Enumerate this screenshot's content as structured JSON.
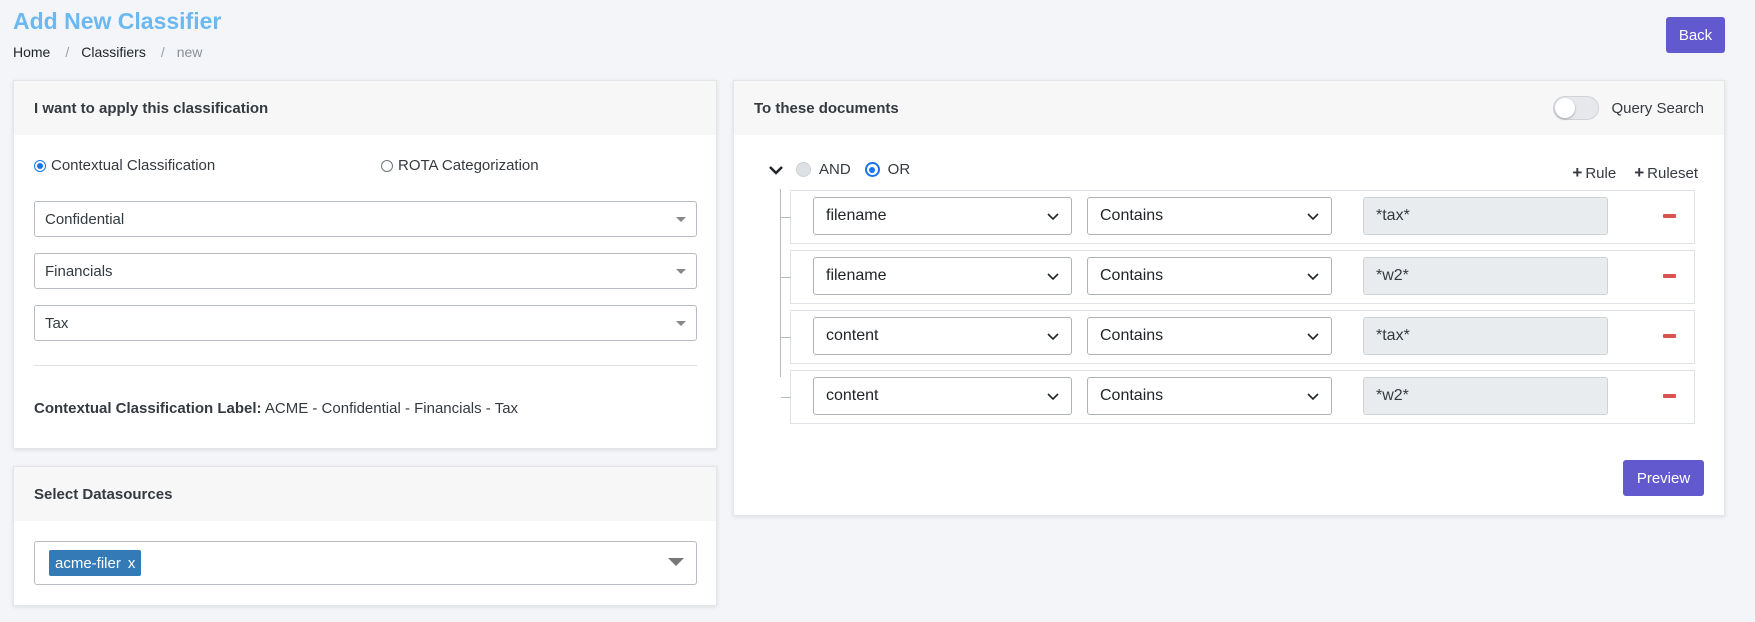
{
  "page": {
    "title": "Add New Classifier"
  },
  "breadcrumb": {
    "home": "Home",
    "sep": "/",
    "classifiers": "Classifiers",
    "current": "new"
  },
  "header": {
    "back_label": "Back"
  },
  "classification_card": {
    "title": "I want to apply this classification",
    "radio_contextual": "Contextual Classification",
    "radio_rota": "ROTA Categorization",
    "selected_mode": "Contextual Classification",
    "select_1": "Confidential",
    "select_2": "Financials",
    "select_3": "Tax",
    "label_title": "Contextual Classification Label:",
    "label_value": "ACME - Confidential - Financials - Tax"
  },
  "datasources_card": {
    "title": "Select Datasources",
    "tag": "acme-filer",
    "tag_remove": "x"
  },
  "documents_card": {
    "title": "To these documents",
    "query_search_label": "Query Search",
    "query_search_on": false,
    "and_label": "AND",
    "or_label": "OR",
    "selected_condition": "OR",
    "add_rule_label": "Rule",
    "add_ruleset_label": "Ruleset",
    "rules": [
      {
        "field": "filename",
        "operator": "Contains",
        "value": "*tax*"
      },
      {
        "field": "filename",
        "operator": "Contains",
        "value": "*w2*"
      },
      {
        "field": "content",
        "operator": "Contains",
        "value": "*tax*"
      },
      {
        "field": "content",
        "operator": "Contains",
        "value": "*w2*"
      }
    ],
    "preview_label": "Preview"
  },
  "colors": {
    "accent": "#6359cf",
    "title": "#6cb8f0",
    "tag": "#337ab7",
    "remove": "#d9534f",
    "radio": "#1a73e8"
  }
}
